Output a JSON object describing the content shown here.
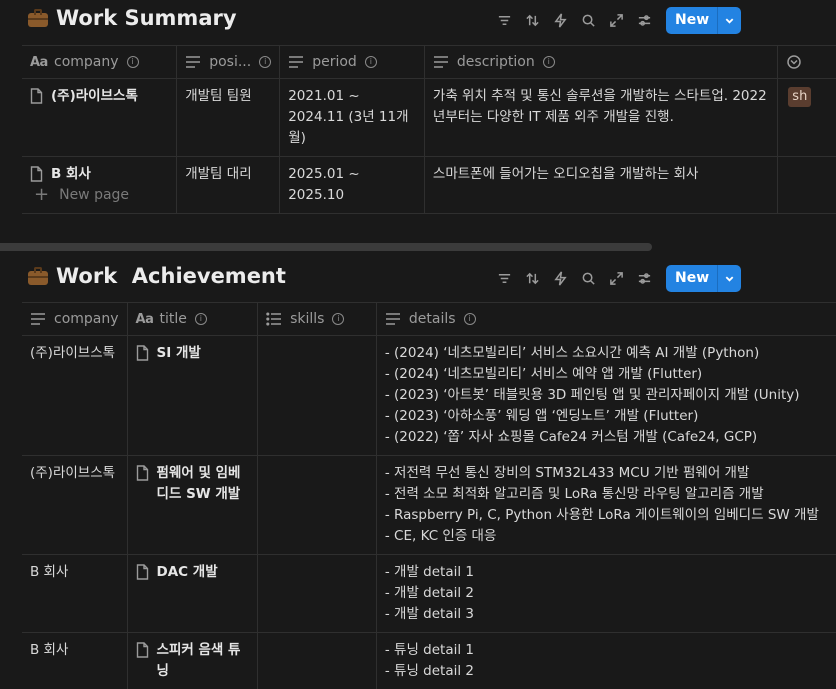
{
  "summary": {
    "title": "Work Summary",
    "new_label": "New",
    "columns": [
      "company",
      "posi...",
      "period",
      "description"
    ],
    "rows": [
      {
        "company": "(주)라이브스톡",
        "position": "개발팀 팀원",
        "period": "2021.01 ~ 2024.11 (3년 11개월)",
        "description": "가축 위치 추적 및 통신 솔루션을 개발하는 스타트업. 2022년부터는 다양한 IT 제품 외주 개발을 진행.",
        "tag": "sh"
      },
      {
        "company": "B 회사",
        "position": "개발팀 대리",
        "period": "2025.01 ~ 2025.10",
        "description": "스마트폰에 들어가는 오디오칩을 개발하는 회사",
        "tag": ""
      }
    ],
    "new_page": "New page"
  },
  "achievement": {
    "title": "Work  Achievement",
    "new_label": "New",
    "columns": [
      "company",
      "title",
      "skills",
      "details"
    ],
    "rows": [
      {
        "company": "(주)라이브스톡",
        "title": "SI 개발",
        "skills": "",
        "details": [
          "- (2024) ‘네츠모빌리티’ 서비스 소요시간 예측 AI 개발 (Python)",
          "- (2024) ‘네츠모빌리티’ 서비스 예약 앱 개발 (Flutter)",
          "- (2023) ‘아트봇’ 태블릿용 3D 페인팅 앱 및 관리자페이지 개발 (Unity)",
          "- (2023) ‘아하소풍’ 웨딩 앱 ‘엔딩노트’ 개발 (Flutter)",
          "- (2022) ‘쫍’ 자사 쇼핑몰 Cafe24 커스텀 개발 (Cafe24, GCP)"
        ]
      },
      {
        "company": "(주)라이브스톡",
        "title": "펌웨어 및 임베디드 SW 개발",
        "skills": "",
        "details": [
          "- 저전력 무선 통신 장비의 STM32L433 MCU 기반 펌웨어 개발",
          "- 전력 소모 최적화 알고리즘 및 LoRa 통신망 라우팅 알고리즘 개발",
          "- Raspberry Pi, C, Python 사용한 LoRa 게이트웨이의 임베디드 SW 개발",
          "- CE, KC 인증 대응"
        ]
      },
      {
        "company": "B 회사",
        "title": "DAC 개발",
        "skills": "",
        "details": [
          "- 개발 detail 1",
          "- 개발 detail 2",
          "- 개발 detail 3"
        ]
      },
      {
        "company": "B 회사",
        "title": "스피커 음색 튜닝",
        "skills": "",
        "details": [
          "- 튜닝 detail 1",
          "- 튜닝 detail 2"
        ]
      }
    ]
  }
}
